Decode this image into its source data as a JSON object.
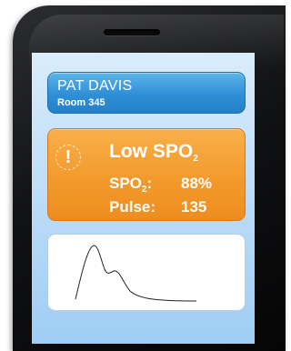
{
  "patient": {
    "name": "PAT DAVIS",
    "room": "Room 345"
  },
  "alert": {
    "icon": "exclamation-icon",
    "title_prefix": "Low SPO",
    "title_sub": "2",
    "spo2_label_prefix": "SPO",
    "spo2_label_sub": "2",
    "spo2_label_suffix": ":",
    "spo2_value": "88%",
    "pulse_label": "Pulse:",
    "pulse_value": "135"
  },
  "colors": {
    "patient_card": "#2f8fd6",
    "alert_card": "#f39a2c",
    "screen_bg": "#c6e1f8"
  }
}
